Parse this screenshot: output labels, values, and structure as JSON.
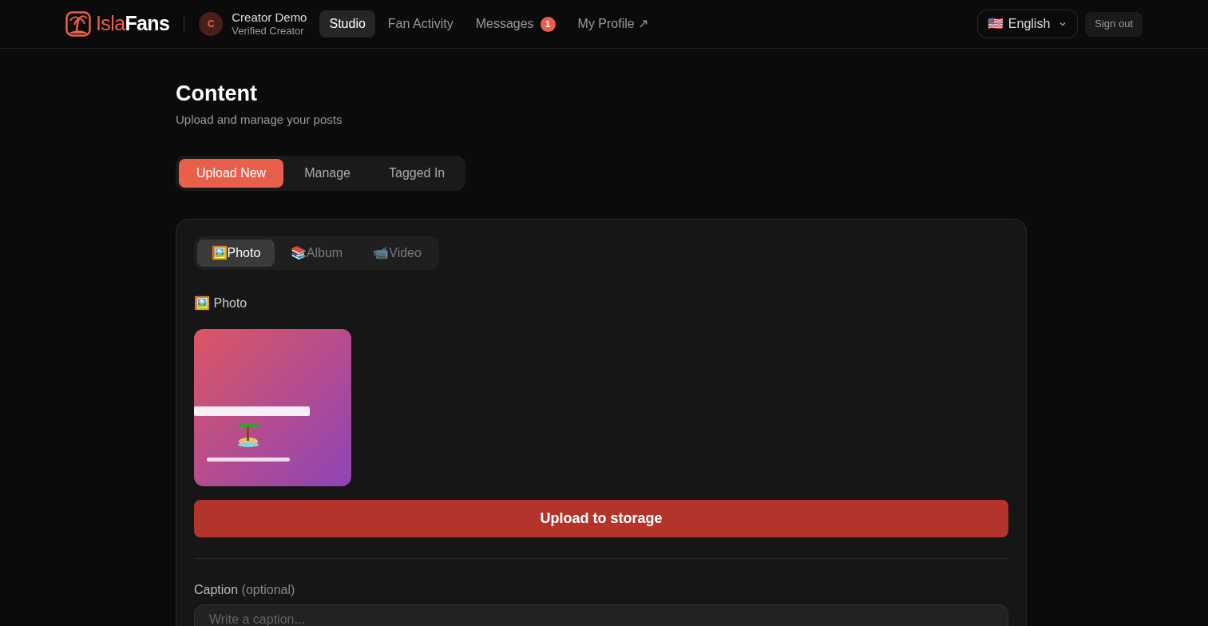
{
  "brand": {
    "first": "Isla",
    "second": "Fans"
  },
  "user": {
    "initial": "C",
    "name": "Creator Demo",
    "role": "Verified Creator"
  },
  "nav": [
    {
      "label": "Studio",
      "selected": true
    },
    {
      "label": "Fan Activity",
      "selected": false
    },
    {
      "label": "Messages",
      "selected": false,
      "badge": "1"
    },
    {
      "label": "My Profile ↗",
      "selected": false
    }
  ],
  "language": {
    "flag": "🇺🇸",
    "label": "English"
  },
  "sign_out": "Sign out",
  "page": {
    "title": "Content",
    "subtitle": "Upload and manage your posts"
  },
  "tabs": [
    {
      "label": "Upload New",
      "selected": true
    },
    {
      "label": "Manage",
      "selected": false
    },
    {
      "label": "Tagged In",
      "selected": false
    }
  ],
  "media_types": [
    {
      "emoji": "🖼️",
      "label": "Photo",
      "selected": true
    },
    {
      "emoji": "📚",
      "label": "Album",
      "selected": false
    },
    {
      "emoji": "📹",
      "label": "Video",
      "selected": false
    }
  ],
  "section": {
    "emoji": "🖼️",
    "label": "Photo"
  },
  "upload_button": "Upload to storage",
  "caption": {
    "label": "Caption",
    "hint": "(optional)",
    "placeholder": "Write a caption..."
  }
}
